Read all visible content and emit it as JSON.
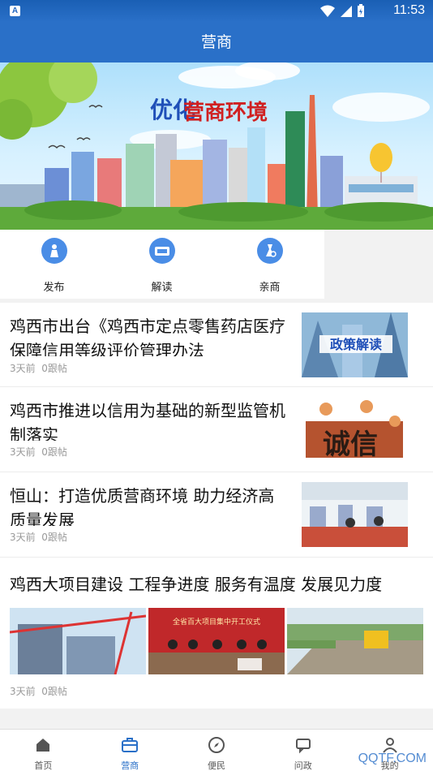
{
  "status": {
    "time": "11:53",
    "notification": "A"
  },
  "header": {
    "title": "营商"
  },
  "banner": {
    "text": "优化营商环境",
    "alt": "优化营商环境 city skyline banner"
  },
  "quicknav": [
    {
      "label": "发布",
      "icon": "person-publish-icon"
    },
    {
      "label": "解读",
      "icon": "interpret-icon"
    },
    {
      "label": "亲商",
      "icon": "business-icon"
    }
  ],
  "news": [
    {
      "title": "鸡西市出台《鸡西市定点零售药店医疗保障信用等级评价管理办法",
      "time": "3天前",
      "replies": "0跟帖",
      "thumb_text": "政策解读"
    },
    {
      "title": "鸡西市推进以信用为基础的新型监管机制落实",
      "time": "3天前",
      "replies": "0跟帖",
      "thumb_text": "诚信"
    },
    {
      "title": "恒山：打造优质营商环境 助力经济高质量发展",
      "time": "3天前",
      "replies": "0跟帖",
      "thumb_text": ""
    }
  ],
  "news_gallery": {
    "title": "鸡西大项目建设 工程争进度 服务有温度 发展见力度",
    "time": "3天前",
    "replies": "0跟帖",
    "images": [
      "construction-photo",
      "ceremony-photo",
      "road-work-photo"
    ],
    "ceremony_text": "全省百大项目集中开工仪式"
  },
  "tabs": [
    {
      "label": "首页",
      "icon": "home-icon",
      "active": false
    },
    {
      "label": "营商",
      "icon": "briefcase-icon",
      "active": true
    },
    {
      "label": "便民",
      "icon": "compass-icon",
      "active": false
    },
    {
      "label": "问政",
      "icon": "chat-icon",
      "active": false
    },
    {
      "label": "我的",
      "icon": "user-icon",
      "active": false
    }
  ],
  "watermark": "QQTF.COM",
  "colors": {
    "primary": "#2a70c8",
    "icon_bg": "#4a8de6",
    "meta": "#999999"
  }
}
